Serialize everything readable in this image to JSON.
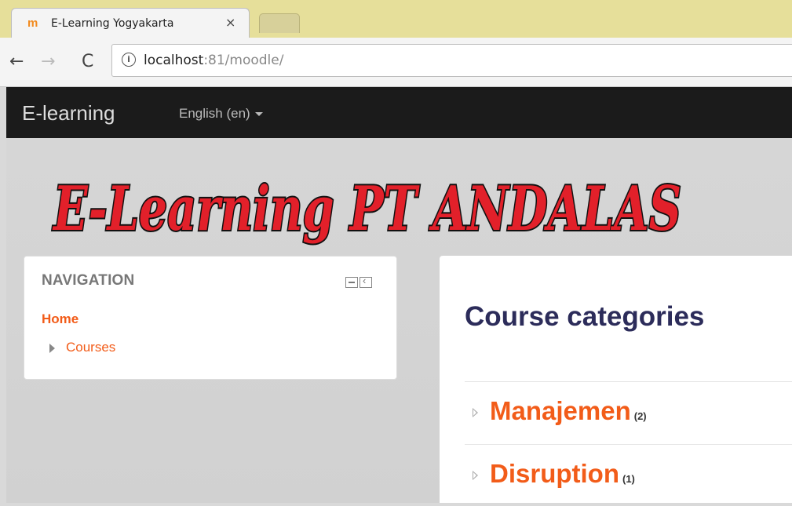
{
  "browser": {
    "tab_title": "E-Learning Yogyakarta",
    "tab_favicon": "moodle-favicon",
    "tab_close": "×",
    "url_host": "localhost",
    "url_rest": ":81/moodle/"
  },
  "navbar": {
    "brand": "E-learning",
    "language": "English (en)"
  },
  "logo": {
    "text": "E-Learning PT ANDALAS"
  },
  "navigation_block": {
    "title": "NAVIGATION",
    "home": "Home",
    "courses": "Courses"
  },
  "main": {
    "heading": "Course categories",
    "categories": [
      {
        "name": "Manajemen",
        "count": "(2)"
      },
      {
        "name": "Disruption",
        "count": "(1)"
      }
    ]
  },
  "colors": {
    "accent": "#f25c19",
    "heading": "#2c2c5a",
    "navbar": "#1b1b1b"
  }
}
